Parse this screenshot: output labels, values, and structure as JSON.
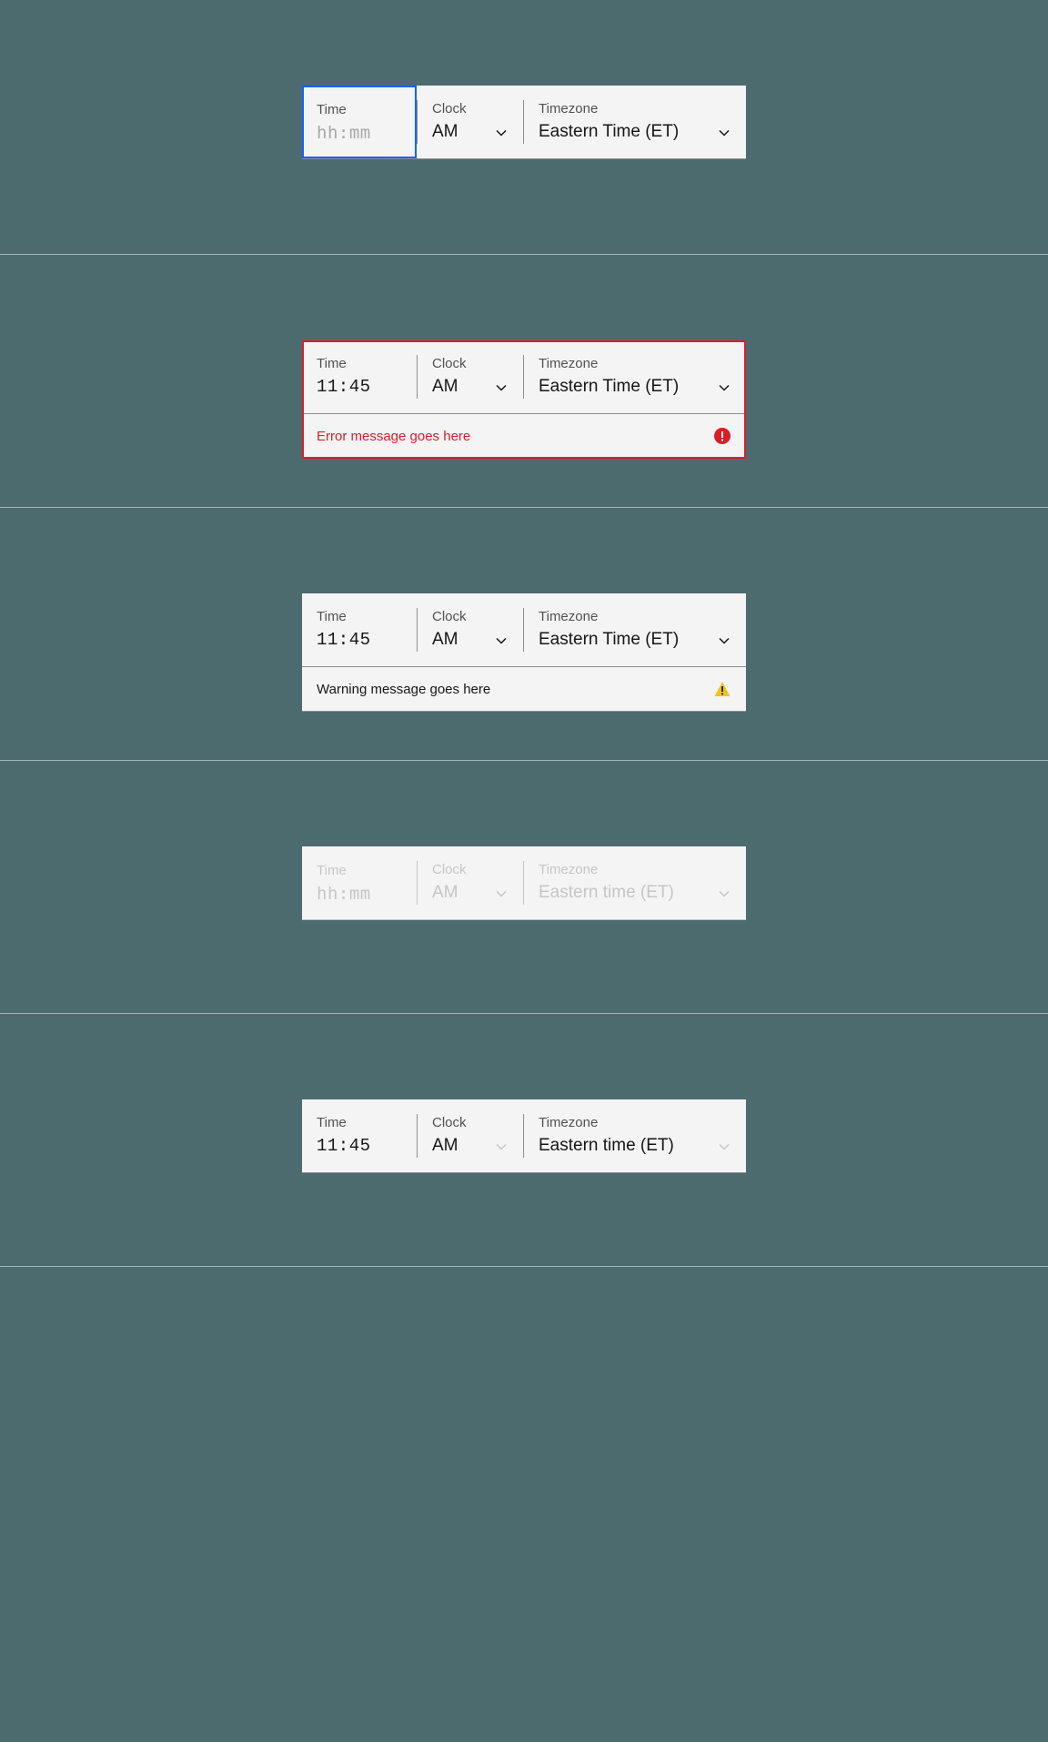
{
  "labels": {
    "time": "Time",
    "clock": "Clock",
    "timezone": "Timezone"
  },
  "placeholder": "hh:mm",
  "values": {
    "time": "11:45",
    "clock": "AM",
    "tz": "Eastern Time (ET)",
    "tz_lower": "Eastern time (ET)"
  },
  "messages": {
    "error": "Error message goes here",
    "warning": "Warning message goes here"
  }
}
